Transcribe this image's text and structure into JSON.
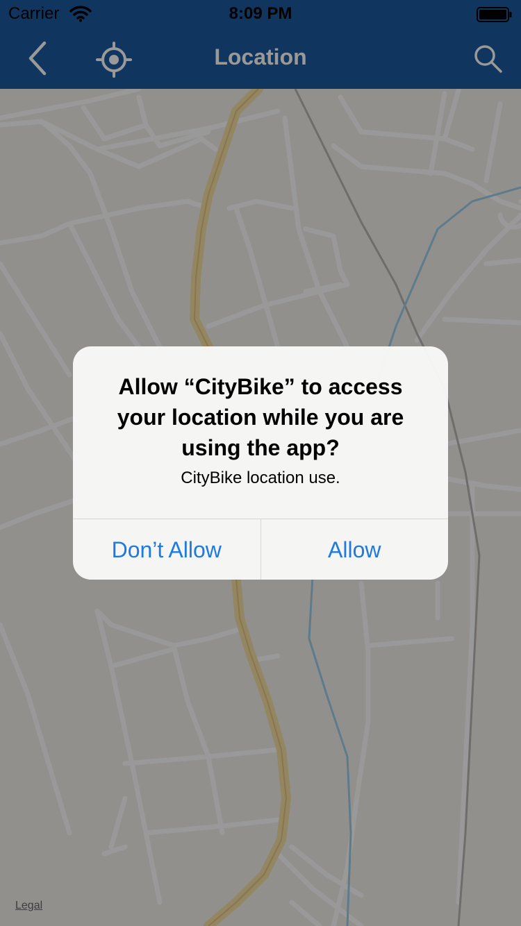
{
  "status_bar": {
    "carrier": "Carrier",
    "time": "8:09 PM"
  },
  "nav_bar": {
    "title": "Location",
    "back_icon": "chevron-left-icon",
    "locate_icon": "locate-crosshair-icon",
    "search_icon": "search-icon",
    "background_color": "#1b5aa0"
  },
  "map": {
    "legal_link": "Legal"
  },
  "alert": {
    "title": "Allow “CityBike” to access your location while you are using the app?",
    "message": "CityBike location use.",
    "dont_allow_label": "Don’t Allow",
    "allow_label": "Allow",
    "button_color": "#1f7ae0"
  }
}
